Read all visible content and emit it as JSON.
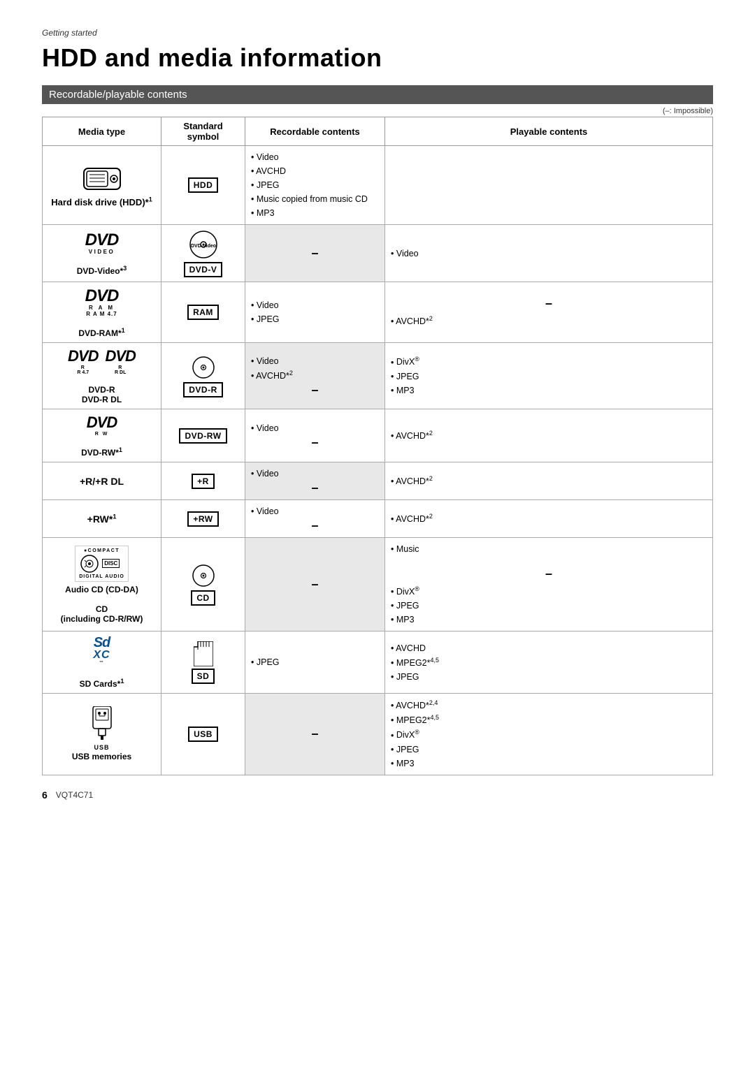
{
  "meta": {
    "section": "Getting started",
    "title": "HDD and media information",
    "section_header": "Recordable/playable contents",
    "impossible_note": "(–: Impossible)",
    "page_number": "6",
    "model_number": "VQT4C71"
  },
  "table": {
    "headers": [
      "Media type",
      "Standard symbol",
      "Recordable contents",
      "Playable contents"
    ],
    "rows": [
      {
        "media_type": "Hard disk drive (HDD)*1",
        "symbol_badge": "HDD",
        "recordable": [
          "Video",
          "AVCHD",
          "JPEG",
          "Music copied from music CD",
          "MP3"
        ],
        "playable": [],
        "media_logo": "HDD"
      },
      {
        "media_type": "DVD-Video*3",
        "symbol_badge": "DVD-V",
        "recordable": [],
        "playable": [
          "Video"
        ],
        "media_logo": "DVD-VIDEO"
      },
      {
        "media_type": "DVD-RAM*1",
        "symbol_badge": "RAM",
        "recordable": [
          "Video",
          "JPEG"
        ],
        "playable": [
          "AVCHD*2"
        ],
        "media_logo": "DVD-RAM"
      },
      {
        "media_type_line1": "DVD-R",
        "media_type_line2": "DVD-R DL",
        "symbol_badge": "DVD-R",
        "recordable": [
          "Video",
          "AVCHD*2"
        ],
        "playable": [
          "DivX®",
          "JPEG",
          "MP3"
        ],
        "media_logo": "DVD-R"
      },
      {
        "media_type": "DVD-RW*1",
        "symbol_badge": "DVD-RW",
        "recordable": [
          "Video"
        ],
        "playable": [
          "AVCHD*2"
        ],
        "media_logo": "DVD-RW"
      },
      {
        "media_type": "+R/+R DL",
        "symbol_badge": "+R",
        "recordable": [
          "Video"
        ],
        "playable": [
          "AVCHD*2"
        ],
        "media_logo": "+R"
      },
      {
        "media_type": "+RW*1",
        "symbol_badge": "+RW",
        "recordable": [
          "Video"
        ],
        "playable": [
          "AVCHD*2"
        ],
        "media_logo": "+RW"
      },
      {
        "media_type_line1": "Audio CD (CD-DA)",
        "media_type_line2": "",
        "media_type_line3": "CD",
        "media_type_line4": "(including CD-R/RW)",
        "symbol_badge": "CD",
        "recordable": [],
        "playable_music": [
          "Music"
        ],
        "playable_other": [
          "DivX®",
          "JPEG",
          "MP3"
        ],
        "media_logo": "CD"
      },
      {
        "media_type": "SD Cards*1",
        "symbol_badge": "SD",
        "recordable": [
          "JPEG"
        ],
        "playable": [
          "AVCHD",
          "MPEG2*4,5",
          "JPEG"
        ],
        "media_logo": "SD"
      },
      {
        "media_type": "USB memories",
        "symbol_badge": "USB",
        "recordable": [],
        "playable": [
          "AVCHD*2,4",
          "MPEG2*4,5",
          "DivX®",
          "JPEG",
          "MP3"
        ],
        "media_logo": "USB"
      }
    ]
  }
}
